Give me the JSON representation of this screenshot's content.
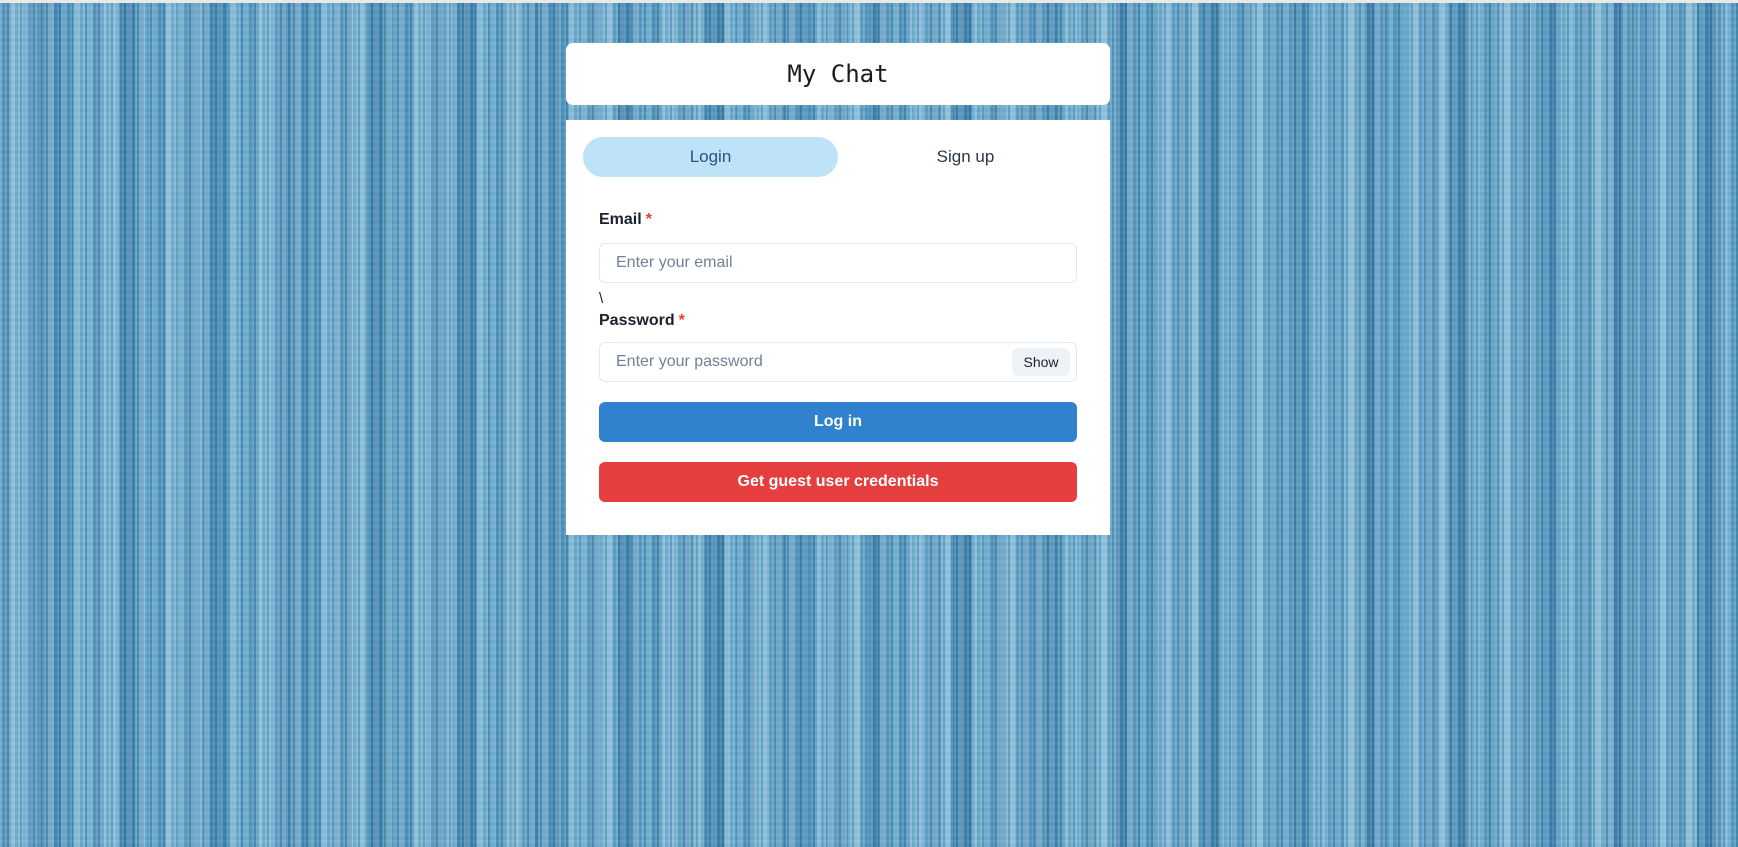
{
  "app": {
    "title": "My Chat"
  },
  "tabs": [
    {
      "label": "Login",
      "active": true
    },
    {
      "label": "Sign up",
      "active": false
    }
  ],
  "form": {
    "email": {
      "label": "Email",
      "required_mark": "*",
      "placeholder": "Enter your email",
      "value": ""
    },
    "stray_text": "\\",
    "password": {
      "label": "Password",
      "required_mark": "*",
      "placeholder": "Enter your password",
      "value": "",
      "toggle_label": "Show"
    },
    "login_button": "Log in",
    "guest_button": "Get guest user credentials"
  },
  "colors": {
    "active_tab_bg": "#bee3f8",
    "login_button": "#3182ce",
    "guest_button": "#e53e3e",
    "required_mark": "#e53e3e",
    "background": "#5aa3c9"
  }
}
